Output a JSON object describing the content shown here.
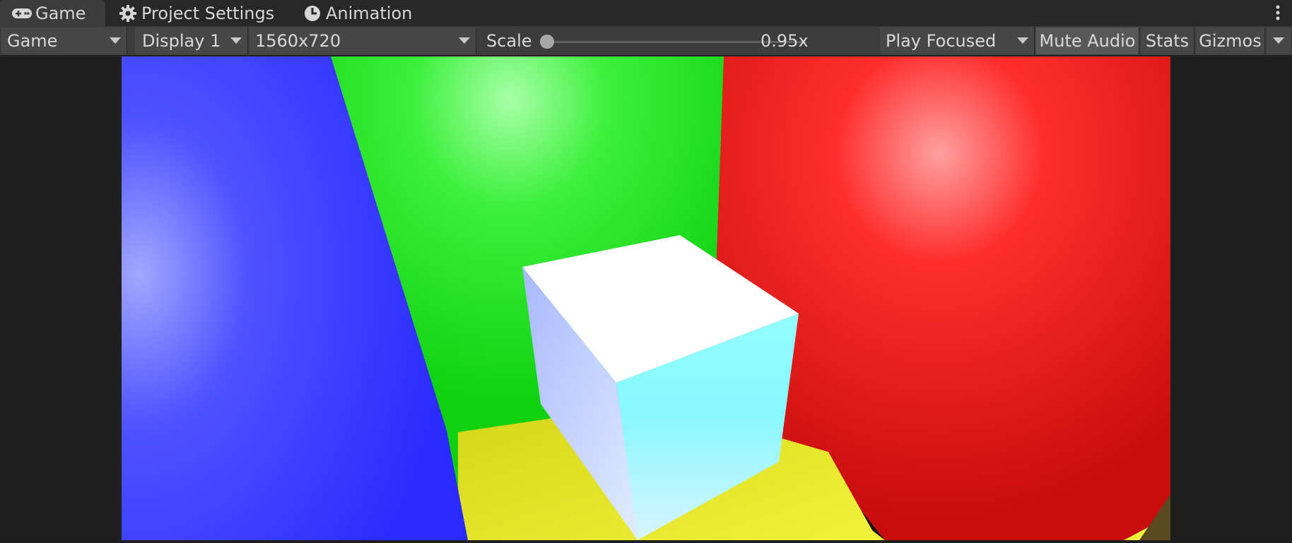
{
  "tabs": [
    {
      "label": "Game",
      "icon": "gamepad-icon",
      "active": true
    },
    {
      "label": "Project Settings",
      "icon": "gear-icon",
      "active": false
    },
    {
      "label": "Animation",
      "icon": "clock-icon",
      "active": false
    }
  ],
  "toolbar": {
    "view_mode": "Game",
    "display": "Display 1",
    "resolution": "1560x720",
    "scale_label": "Scale",
    "scale_value": "0.95x",
    "play_mode": "Play Focused",
    "mute_audio": "Mute Audio",
    "stats": "Stats",
    "gizmos": "Gizmos"
  },
  "scene": {
    "colors": {
      "left_wall": "#2b2bff",
      "back_wall": "#1ce41c",
      "right_wall": "#ff1a1a",
      "floor": "#e4e41c",
      "cube_top": "#ffffff",
      "cube_front": "#90ffff",
      "cube_side": "#b8c8ff"
    }
  }
}
